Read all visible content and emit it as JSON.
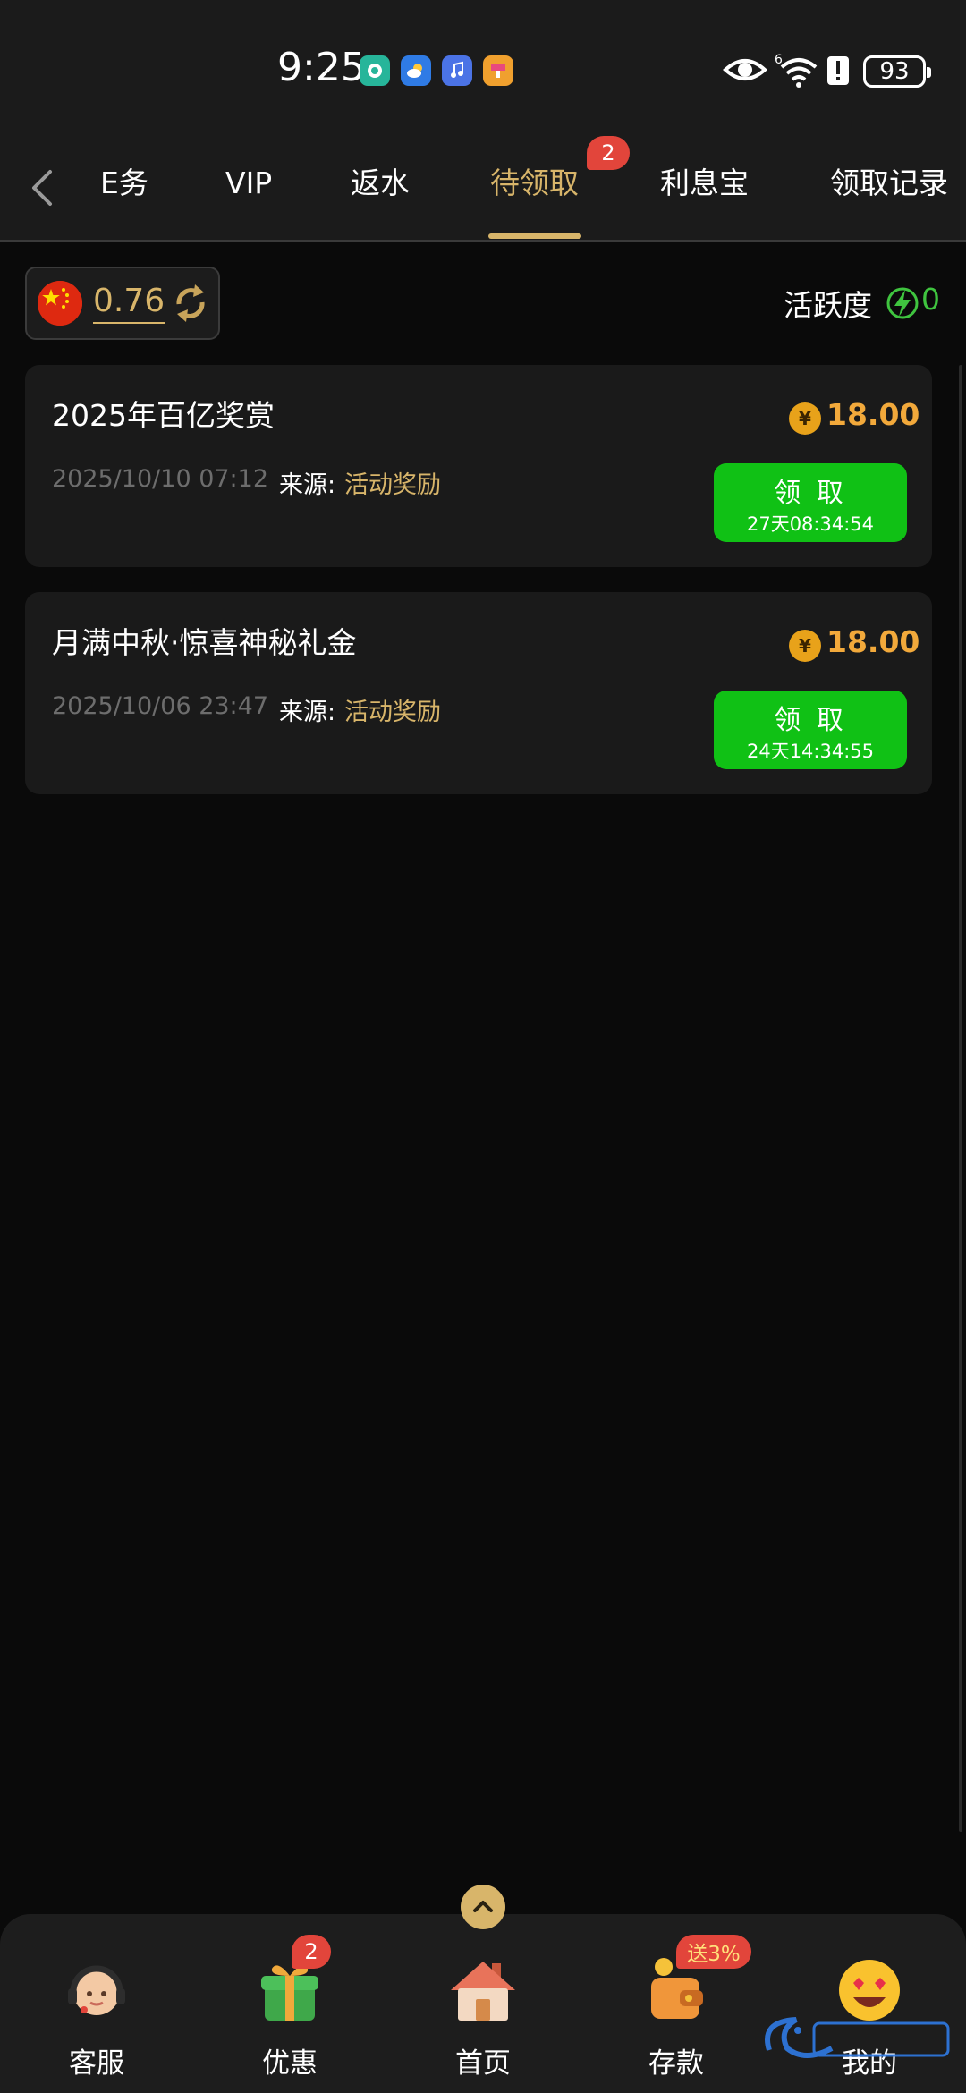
{
  "status_bar": {
    "time": "9:25",
    "battery": "93",
    "signal_label": "6"
  },
  "tabs": [
    {
      "label": "任务",
      "visible_text": "E务"
    },
    {
      "label": "VIP"
    },
    {
      "label": "返水"
    },
    {
      "label": "待领取",
      "active": true,
      "badge": "2"
    },
    {
      "label": "利息宝"
    },
    {
      "label": "领取记录"
    }
  ],
  "balance": {
    "value": "0.76",
    "flag": "china-flag-icon"
  },
  "activity": {
    "label": "活跃度",
    "value": "0"
  },
  "rewards": [
    {
      "title": "2025年百亿奖赏",
      "date": "2025/10/10 07:12",
      "source_label": "来源:",
      "source_value": "活动奖励",
      "amount": "18.00",
      "currency_symbol": "¥",
      "claim_label": "领 取",
      "timer": "27天08:34:54"
    },
    {
      "title": "月满中秋·惊喜神秘礼金",
      "date": "2025/10/06 23:47",
      "source_label": "来源:",
      "source_value": "活动奖励",
      "amount": "18.00",
      "currency_symbol": "¥",
      "claim_label": "领 取",
      "timer": "24天14:34:55"
    }
  ],
  "bottom_nav": {
    "items": [
      {
        "label": "客服",
        "icon": "customer-service-icon"
      },
      {
        "label": "优惠",
        "icon": "gift-icon",
        "badge": "2"
      },
      {
        "label": "首页",
        "icon": "home-icon"
      },
      {
        "label": "存款",
        "icon": "wallet-icon",
        "promo": "送3%"
      },
      {
        "label": "我的",
        "icon": "smiley-icon"
      }
    ]
  },
  "colors": {
    "accent_gold": "#d8b56a",
    "claim_green": "#10c115",
    "badge_red": "#e2453b",
    "amount_orange": "#f2a93b"
  }
}
